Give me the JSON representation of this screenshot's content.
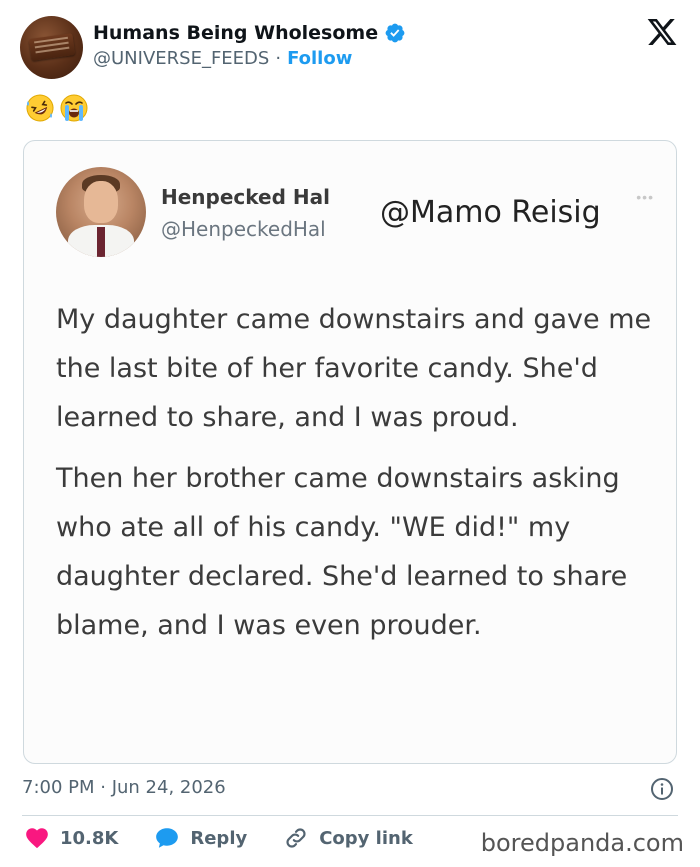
{
  "header": {
    "display_name": "Humans Being Wholesome",
    "handle": "@UNIVERSE_FEEDS",
    "separator": "·",
    "follow_label": "Follow"
  },
  "post": {
    "emojis": [
      "rolling-on-floor-laughing",
      "loudly-crying"
    ],
    "quoted": {
      "name": "Henpecked Hal",
      "handle": "@HenpeckedHal",
      "mention": "@Mamo Reisig",
      "paragraphs": [
        "My daughter came downstairs and gave me the last bite of her favorite candy. She'd learned to share, and I was proud.",
        "Then her brother came downstairs asking who ate all of his candy. \"WE did!\" my daughter declared. She'd learned to share blame, and I was even prouder."
      ]
    },
    "timestamp": "7:00 PM · Jun 24, 2026"
  },
  "actions": {
    "likes": "10.8K",
    "reply_label": "Reply",
    "copy_label": "Copy link"
  },
  "watermark": "boredpanda.com",
  "colors": {
    "accent": "#1d9bf0",
    "like": "#f91880",
    "muted": "#536471"
  }
}
